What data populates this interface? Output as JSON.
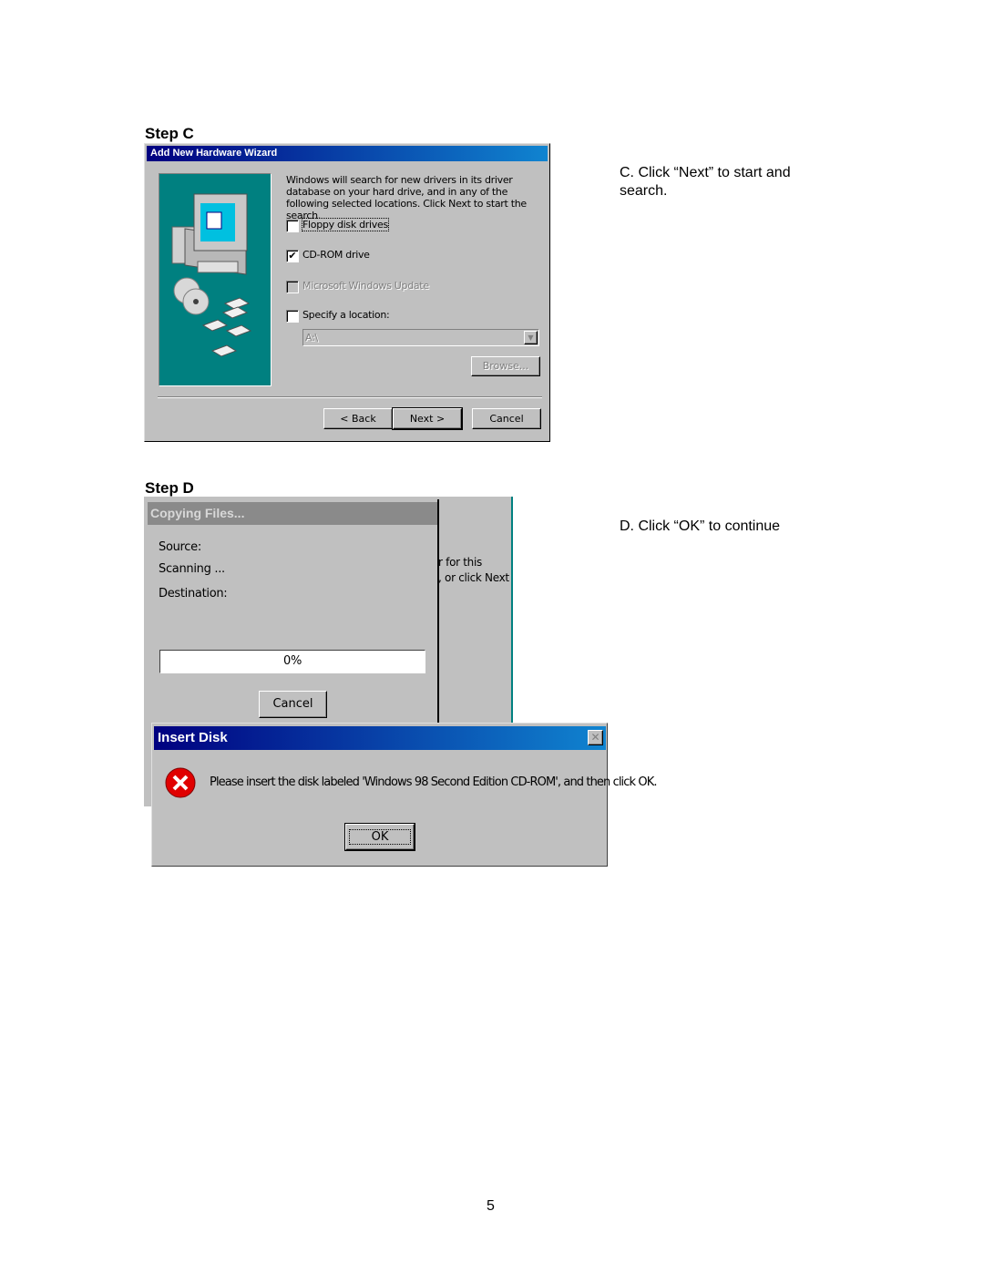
{
  "step_c": {
    "heading": "Step C",
    "instruction": "C. Click “Next” to start and search.",
    "window": {
      "title": "Add New Hardware Wizard",
      "description": "Windows will search for new drivers in its driver database on your hard drive, and in any of the following selected locations. Click Next to start the search.",
      "options": [
        {
          "label": "Floppy disk drives",
          "checked": false,
          "enabled": true
        },
        {
          "label": "CD-ROM drive",
          "checked": true,
          "enabled": true
        },
        {
          "label": "Microsoft Windows Update",
          "checked": false,
          "enabled": false
        },
        {
          "label": "Specify a location:",
          "checked": false,
          "enabled": true
        }
      ],
      "location_value": "A:\\",
      "browse_label": "Browse...",
      "back_label": "< Back",
      "next_label": "Next >",
      "cancel_label": "Cancel"
    }
  },
  "step_d": {
    "heading": "Step D",
    "instruction": "D. Click “OK” to continue",
    "background_text_1": "r for this",
    "background_text_2": ", or click Next",
    "copying": {
      "title": "Copying Files...",
      "source_label": "Source:",
      "status": "Scanning ...",
      "destination_label": "Destination:",
      "progress_text": "0%",
      "progress": 0,
      "cancel_label": "Cancel"
    },
    "insert_disk": {
      "title": "Insert Disk",
      "message": "Please insert the disk labeled 'Windows 98 Second Edition CD-ROM', and then click OK.",
      "ok_label": "OK"
    }
  },
  "page_number": "5",
  "colors": {
    "titlebar": "#000080",
    "panel": "#008080",
    "window": "#c0c0c0",
    "error": "#e00000"
  }
}
